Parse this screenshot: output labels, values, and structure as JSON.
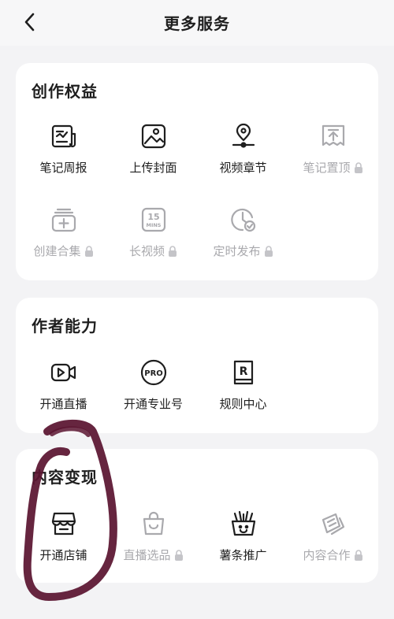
{
  "header": {
    "title": "更多服务",
    "back_icon": "chevron-left-icon"
  },
  "sections": [
    {
      "title": "创作权益",
      "items": [
        {
          "label": "笔记周报",
          "icon": "report-icon",
          "locked": false
        },
        {
          "label": "上传封面",
          "icon": "image-icon",
          "locked": false
        },
        {
          "label": "视频章节",
          "icon": "chapter-pin-icon",
          "locked": false
        },
        {
          "label": "笔记置顶",
          "icon": "pin-top-icon",
          "locked": true
        },
        {
          "label": "创建合集",
          "icon": "collection-add-icon",
          "locked": true
        },
        {
          "label": "长视频",
          "icon": "long-video-icon",
          "locked": true,
          "badge_text": [
            "15",
            "MINS"
          ]
        },
        {
          "label": "定时发布",
          "icon": "timer-icon",
          "locked": true
        }
      ]
    },
    {
      "title": "作者能力",
      "items": [
        {
          "label": "开通直播",
          "icon": "live-camera-icon",
          "locked": false
        },
        {
          "label": "开通专业号",
          "icon": "pro-icon",
          "locked": false,
          "badge_text": [
            "PRO"
          ]
        },
        {
          "label": "规则中心",
          "icon": "rules-icon",
          "locked": false,
          "badge_text": [
            "R"
          ]
        }
      ]
    },
    {
      "title": "内容变现",
      "items": [
        {
          "label": "开通店铺",
          "icon": "store-icon",
          "locked": false
        },
        {
          "label": "直播选品",
          "icon": "shopping-bag-icon",
          "locked": true
        },
        {
          "label": "薯条推广",
          "icon": "fries-icon",
          "locked": false
        },
        {
          "label": "内容合作",
          "icon": "cooperation-icon",
          "locked": true
        }
      ]
    }
  ],
  "colors": {
    "text": "#1f1f1f",
    "disabled": "#a9a9ad",
    "annotation": "#5a1430"
  }
}
